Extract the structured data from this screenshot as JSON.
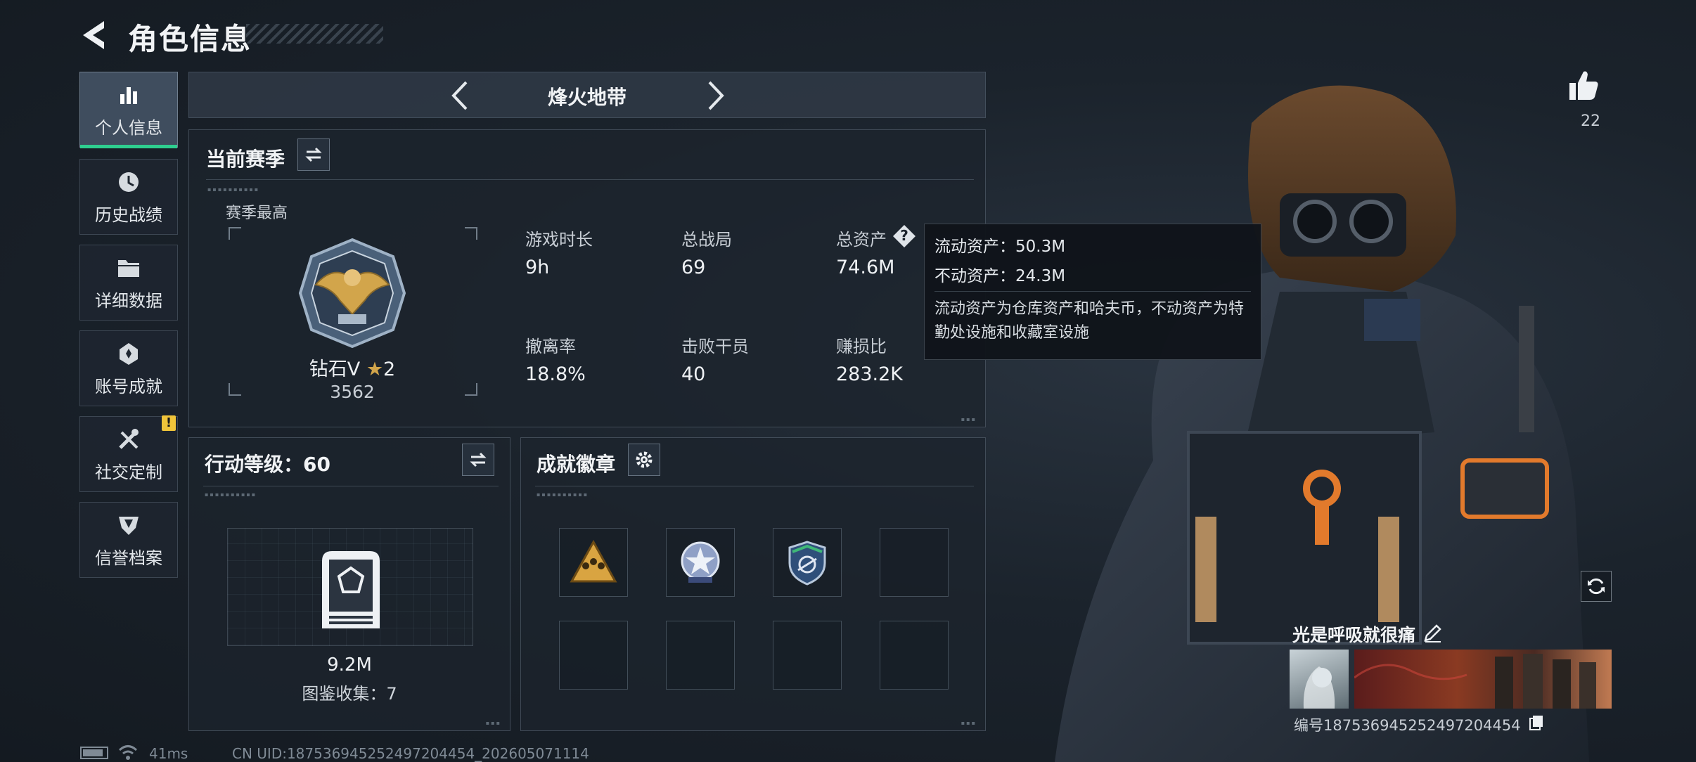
{
  "header": {
    "title": "角色信息"
  },
  "sidebar": {
    "items": [
      {
        "label": "个人信息",
        "icon": "bar-chart-icon",
        "active": true
      },
      {
        "label": "历史战绩",
        "icon": "history-clock-icon",
        "active": false
      },
      {
        "label": "详细数据",
        "icon": "folder-icon",
        "active": false
      },
      {
        "label": "账号成就",
        "icon": "achievement-icon",
        "active": false
      },
      {
        "label": "社交定制",
        "icon": "tools-icon",
        "active": false,
        "badge": "!"
      },
      {
        "label": "信誉档案",
        "icon": "credit-shield-icon",
        "active": false
      }
    ]
  },
  "mode_bar": {
    "title": "烽火地带"
  },
  "season_panel": {
    "title": "当前赛季",
    "best_label": "赛季最高",
    "rank_name": "钻石V",
    "rank_stars": "2",
    "rank_score": "3562",
    "stats": [
      {
        "label": "游戏时长",
        "value": "9h"
      },
      {
        "label": "总战局",
        "value": "69"
      },
      {
        "label": "总资产",
        "value": "74.6M"
      },
      {
        "label": "撤离率",
        "value": "18.8%"
      },
      {
        "label": "击败干员",
        "value": "40"
      },
      {
        "label": "赚损比",
        "value": "283.2K"
      }
    ],
    "help_icon": "?"
  },
  "tooltip": {
    "liquid": "流动资产：50.3M",
    "fixed": "不动资产：24.3M",
    "desc": "流动资产为仓库资产和哈夫币，不动资产为特勤处设施和收藏室设施"
  },
  "action_panel": {
    "title": "行动等级：60",
    "value": "9.2M",
    "collection": "图鉴收集：7"
  },
  "badge_panel": {
    "title": "成就徽章",
    "badges": [
      "squad-badge-icon",
      "star-wheel-badge-icon",
      "shield-wing-badge-icon"
    ]
  },
  "profile": {
    "likes": "22",
    "nickname": "光是呼吸就很痛",
    "id_text": "编号1875369452524972044​54"
  },
  "status_bar": {
    "ping": "41ms",
    "uid": "CN UID:1875369452524972044​54_202605071114"
  },
  "colors": {
    "accent_green": "#2ecf8f",
    "warning": "#f0c43a",
    "gold": "#d2a54b"
  }
}
